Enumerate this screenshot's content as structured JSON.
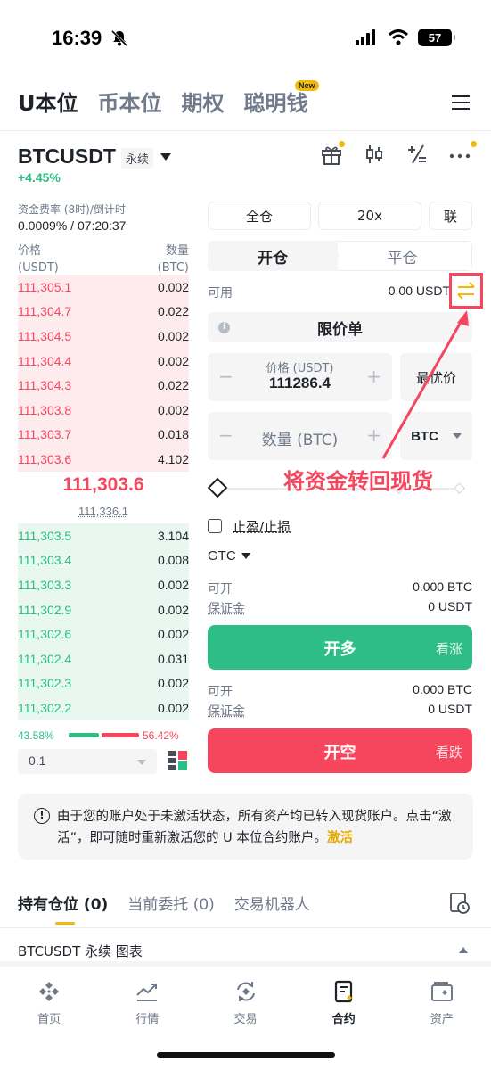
{
  "status_bar": {
    "time": "16:39",
    "battery": "57"
  },
  "top_tabs": [
    {
      "label": "U本位",
      "active": true
    },
    {
      "label": "币本位",
      "active": false
    },
    {
      "label": "期权",
      "active": false
    },
    {
      "label": "聪明钱",
      "active": false,
      "badge": "New"
    }
  ],
  "symbol": {
    "name": "BTCUSDT",
    "contract_type": "永续",
    "change": "+4.45%"
  },
  "funding": {
    "label": "资金费率 (8时)/倒计时",
    "value": "0.0009% / 07:20:37"
  },
  "order_book": {
    "price_header": "价格",
    "price_unit": "(USDT)",
    "qty_header": "数量",
    "qty_unit": "(BTC)",
    "asks": [
      {
        "price": "111,305.1",
        "qty": "0.002"
      },
      {
        "price": "111,304.7",
        "qty": "0.022"
      },
      {
        "price": "111,304.5",
        "qty": "0.002"
      },
      {
        "price": "111,304.4",
        "qty": "0.002"
      },
      {
        "price": "111,304.3",
        "qty": "0.022"
      },
      {
        "price": "111,303.8",
        "qty": "0.002"
      },
      {
        "price": "111,303.7",
        "qty": "0.018"
      },
      {
        "price": "111,303.6",
        "qty": "4.102"
      }
    ],
    "last_price": "111,303.6",
    "mark_price": "111,336.1",
    "bids": [
      {
        "price": "111,303.5",
        "qty": "3.104"
      },
      {
        "price": "111,303.4",
        "qty": "0.008"
      },
      {
        "price": "111,303.3",
        "qty": "0.002"
      },
      {
        "price": "111,302.9",
        "qty": "0.002"
      },
      {
        "price": "111,302.6",
        "qty": "0.002"
      },
      {
        "price": "111,302.4",
        "qty": "0.031"
      },
      {
        "price": "111,302.3",
        "qty": "0.002"
      },
      {
        "price": "111,302.2",
        "qty": "0.002"
      }
    ],
    "buy_ratio": "43.58%",
    "sell_ratio": "56.42%",
    "step": "0.1"
  },
  "trade": {
    "margin_mode": "全仓",
    "leverage": "20x",
    "asset_mode": "联",
    "open_tab": "开仓",
    "close_tab": "平仓",
    "available_label": "可用",
    "available_value": "0.00 USDT",
    "order_type": "限价单",
    "price_label": "价格 (USDT)",
    "price_value": "111286.4",
    "best_price": "最优价",
    "qty_placeholder": "数量 (BTC)",
    "qty_unit": "BTC",
    "annotation": "将资金转回现货",
    "tpsl": "止盈/止损",
    "tif": "GTC",
    "long": {
      "can_open_label": "可开",
      "can_open_value": "0.000 BTC",
      "margin_label": "保证金",
      "margin_value": "0 USDT",
      "button": "开多",
      "sub": "看涨"
    },
    "short": {
      "can_open_label": "可开",
      "can_open_value": "0.000 BTC",
      "margin_label": "保证金",
      "margin_value": "0 USDT",
      "button": "开空",
      "sub": "看跌"
    }
  },
  "notice": {
    "text": "由于您的账户处于未激活状态，所有资产均已转入现货账户。点击“激活”，即可随时重新激活您的 U 本位合约账户。",
    "link": "激活"
  },
  "position_tabs": [
    {
      "label": "持有仓位 (0)",
      "active": true
    },
    {
      "label": "当前委托 (0)",
      "active": false
    },
    {
      "label": "交易机器人",
      "active": false
    }
  ],
  "chart_bar": {
    "label": "BTCUSDT 永续  图表"
  },
  "nav": [
    {
      "label": "首页",
      "icon": "home-icon",
      "active": false
    },
    {
      "label": "行情",
      "icon": "markets-icon",
      "active": false
    },
    {
      "label": "交易",
      "icon": "trade-icon",
      "active": false
    },
    {
      "label": "合约",
      "icon": "futures-icon",
      "active": true
    },
    {
      "label": "资产",
      "icon": "wallet-icon",
      "active": false
    }
  ],
  "colors": {
    "buy": "#2ebd85",
    "sell": "#f6465d",
    "brand": "#f0b90b"
  }
}
